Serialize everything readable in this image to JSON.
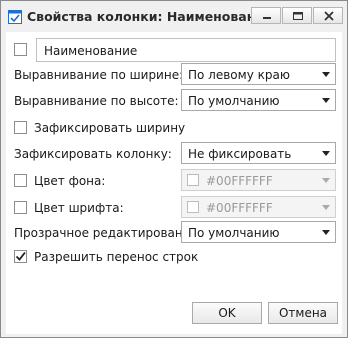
{
  "window": {
    "title": "Свойства колонки: Наименование"
  },
  "name_field": {
    "value": "Наименование",
    "checked": false
  },
  "h_align": {
    "label": "Выравнивание по ширине:",
    "value": "По левому краю"
  },
  "v_align": {
    "label": "Выравнивание по высоте:",
    "value": "По умолчанию"
  },
  "fix_width": {
    "label": "Зафиксировать ширину",
    "checked": false
  },
  "fix_column": {
    "label": "Зафиксировать колонку:",
    "value": "Не фиксировать"
  },
  "bg_color": {
    "label": "Цвет фона:",
    "value": "#00FFFFFF",
    "checked": false
  },
  "font_color": {
    "label": "Цвет шрифта:",
    "value": "#00FFFFFF",
    "checked": false
  },
  "transparent_edit": {
    "label": "Прозрачное редактирование:",
    "value": "По умолчанию"
  },
  "word_wrap": {
    "label": "Разрешить перенос строк",
    "checked": true
  },
  "buttons": {
    "ok": "OK",
    "cancel": "Отмена"
  },
  "colors": {
    "accent": "#1e6fd0",
    "border": "#8a8a8a",
    "background": "#f0f0f0"
  },
  "icons": {
    "app": "window-check-icon",
    "minimize": "minimize-icon",
    "maximize": "maximize-icon",
    "close": "close-icon"
  }
}
